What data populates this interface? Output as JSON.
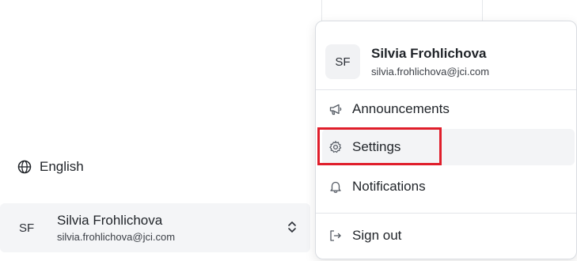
{
  "sidebar": {
    "language_label": "English",
    "language_icon": "globe-icon",
    "user": {
      "initials": "SF",
      "name": "Silvia Frohlichova",
      "email": "silvia.frohlichova@jci.com",
      "toggle_icon": "chevron-up-down-icon"
    }
  },
  "menu": {
    "header": {
      "initials": "SF",
      "name": "Silvia Frohlichova",
      "email": "silvia.frohlichova@jci.com"
    },
    "items": [
      {
        "label": "Announcements",
        "icon": "megaphone-icon"
      },
      {
        "label": "Settings",
        "icon": "gear-icon",
        "active": true
      },
      {
        "label": "Notifications",
        "icon": "bell-icon"
      }
    ],
    "signout": {
      "label": "Sign out",
      "icon": "sign-out-icon"
    }
  },
  "colors": {
    "highlight": "#e01e2b",
    "active_bg": "#f3f4f6",
    "user_row_bg": "#f4f5f7"
  }
}
